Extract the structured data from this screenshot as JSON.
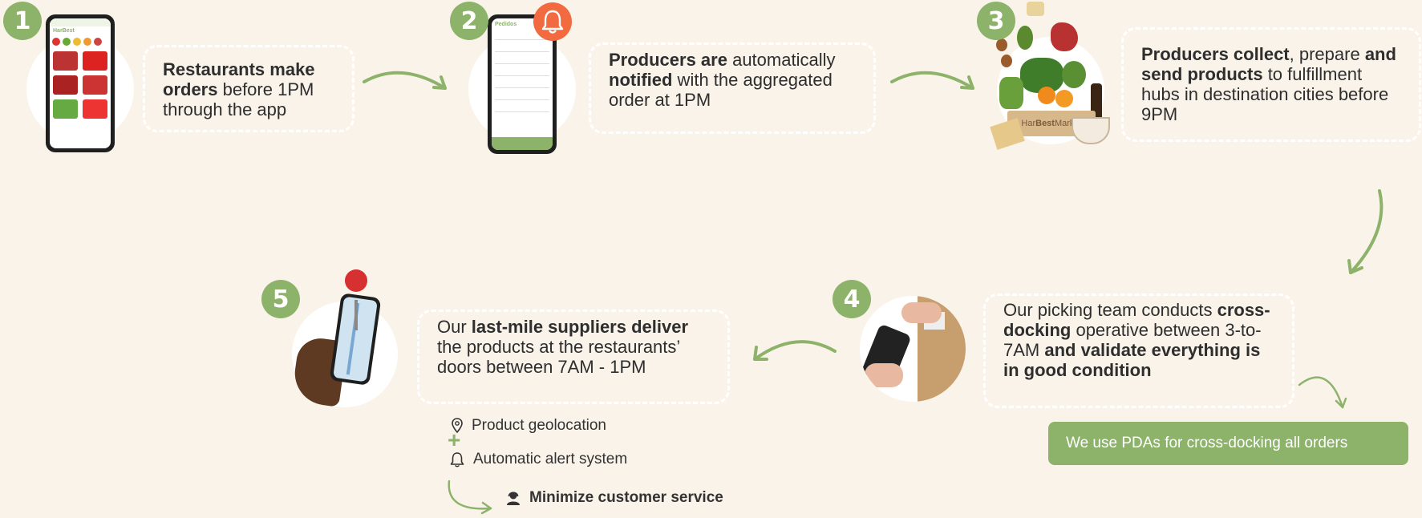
{
  "steps": [
    {
      "number": "1",
      "text_parts": [
        {
          "t": "Restaurants make orders",
          "b": true
        },
        {
          "t": " before 1PM through the app",
          "b": false
        }
      ]
    },
    {
      "number": "2",
      "text_parts": [
        {
          "t": "Producers are",
          "b": true
        },
        {
          "t": " automatically ",
          "b": false
        },
        {
          "t": "notified",
          "b": true
        },
        {
          "t": " with the aggregated order at 1PM",
          "b": false
        }
      ]
    },
    {
      "number": "3",
      "text_parts": [
        {
          "t": "Producers collect",
          "b": true
        },
        {
          "t": ", prepare ",
          "b": false
        },
        {
          "t": "and send products",
          "b": true
        },
        {
          "t": " to fulfillment hubs in destination cities before 9PM",
          "b": false
        }
      ]
    },
    {
      "number": "4",
      "text_parts": [
        {
          "t": "Our picking team conducts ",
          "b": false
        },
        {
          "t": "cross-docking",
          "b": true
        },
        {
          "t": " operative between 3-to-7AM ",
          "b": false
        },
        {
          "t": "and validate everything is in good condition",
          "b": true
        }
      ]
    },
    {
      "number": "5",
      "text_parts": [
        {
          "t": "Our ",
          "b": false
        },
        {
          "t": "last-mile suppliers deliver",
          "b": true
        },
        {
          "t": " the products at the restaurants’ doors between 7AM - 1PM",
          "b": false
        }
      ]
    }
  ],
  "pda_banner": "We use PDAs for cross-docking all orders",
  "features": {
    "geolocation": "Product geolocation",
    "plus": "+",
    "alerts": "Automatic alert system",
    "minimize": "Minimize customer service"
  },
  "crate_label": {
    "pre": "Har",
    "bold": "Best",
    "post": " Market"
  },
  "icons": [
    "bell-icon",
    "location-pin-icon",
    "bell-outline-icon",
    "support-agent-icon",
    "arrow-icon"
  ],
  "colors": {
    "background": "#faf3ea",
    "accent_green": "#8db36a",
    "bell_orange": "#f26a3f",
    "text": "#2e2e2e"
  }
}
